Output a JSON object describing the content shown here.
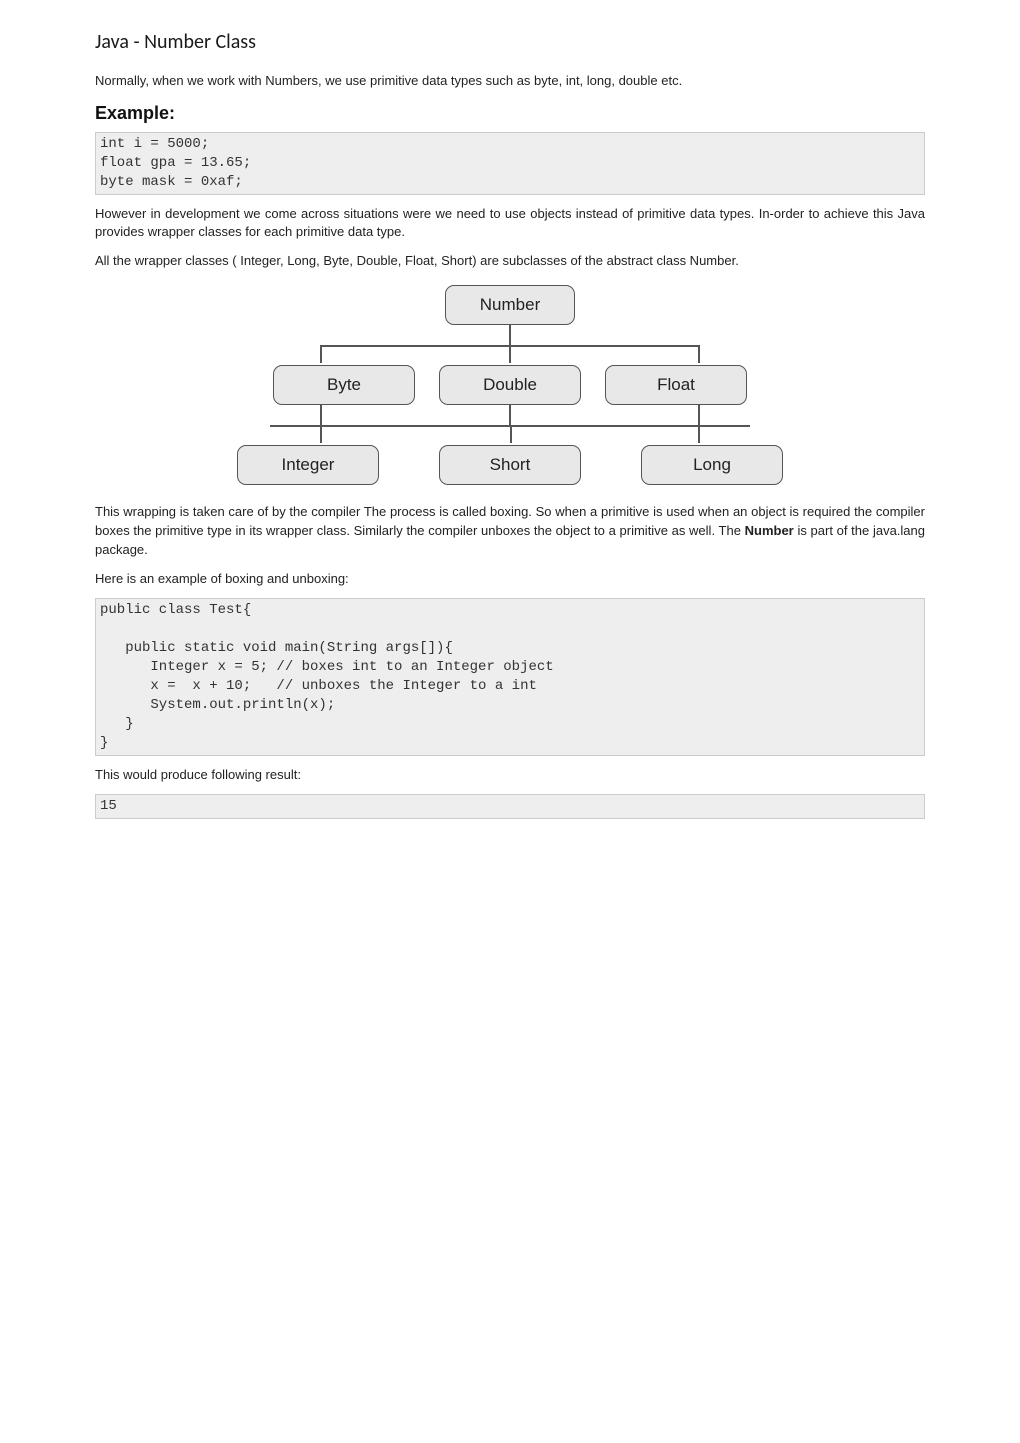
{
  "title": "Java - Number Class",
  "p1": "Normally, when we work with Numbers, we use primitive data types such as byte, int, long, double etc.",
  "exampleHeading": "Example:",
  "code1": "int i = 5000;\nfloat gpa = 13.65;\nbyte mask = 0xaf;",
  "p2": "However in development we come across situations were we need to use objects instead of primitive data types. In-order to achieve this Java provides wrapper classes for each primitive data type.",
  "p3": "All the wrapper classes ( Integer, Long, Byte, Double, Float, Short) are subclasses of the abstract class Number.",
  "diagram": {
    "root": "Number",
    "row2": [
      "Byte",
      "Double",
      "Float"
    ],
    "row3": [
      "Integer",
      "Short",
      "Long"
    ]
  },
  "p4a": "This wrapping is taken care of by the compiler The process is called boxing. So when a primitive is used when an object is required the compiler boxes the primitive type in its wrapper class. Similarly the compiler unboxes the object to a primitive as well. The ",
  "p4bold": "Number",
  "p4b": " is part of the java.lang package.",
  "p5": "Here is an example of boxing and unboxing:",
  "code2": "public class Test{\n\n   public static void main(String args[]){\n      Integer x = 5; // boxes int to an Integer object\n      x =  x + 10;   // unboxes the Integer to a int\n      System.out.println(x); \n   }\n}",
  "p6": "This would produce following result:",
  "code3": "15"
}
